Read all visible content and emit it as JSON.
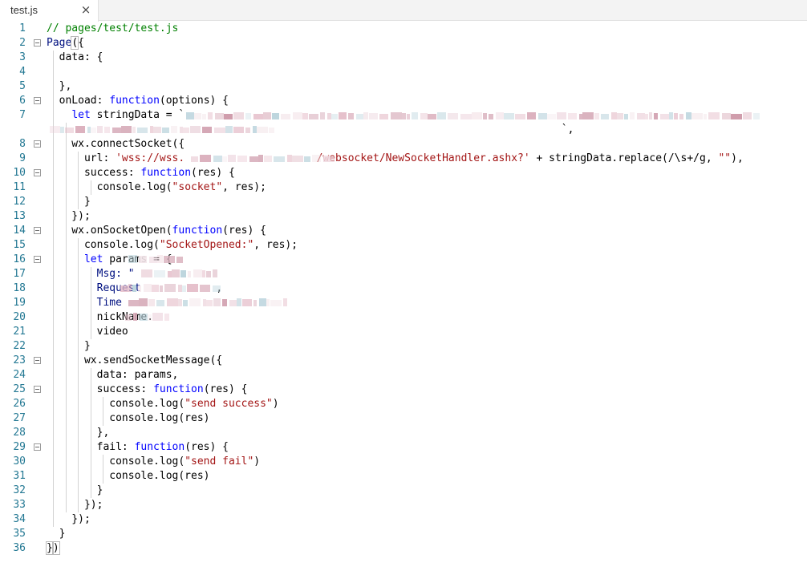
{
  "tab": {
    "title": "test.js",
    "close_icon": "close-icon"
  },
  "code_lines": [
    {
      "n": "1",
      "fold": false,
      "tokens": [
        {
          "t": "// pages/test/test.js",
          "c": "#008000"
        }
      ]
    },
    {
      "n": "2",
      "fold": true,
      "tokens": [
        {
          "t": "Page",
          "c": "#001080"
        },
        {
          "t": "(",
          "c": "#000000",
          "hl": true
        },
        {
          "t": "{",
          "c": "#000000"
        }
      ]
    },
    {
      "n": "3",
      "fold": false,
      "tokens": [
        {
          "t": "  data: {",
          "c": "#000000"
        }
      ]
    },
    {
      "n": "4",
      "fold": false,
      "tokens": []
    },
    {
      "n": "5",
      "fold": false,
      "tokens": [
        {
          "t": "  },",
          "c": "#000000"
        }
      ]
    },
    {
      "n": "6",
      "fold": true,
      "tokens": [
        {
          "t": "  onLoad: ",
          "c": "#000000"
        },
        {
          "t": "function",
          "c": "#0000ff"
        },
        {
          "t": "(options) {",
          "c": "#000000"
        }
      ]
    },
    {
      "n": "7",
      "fold": false,
      "tokens": [
        {
          "t": "    ",
          "c": "#000000"
        },
        {
          "t": "let",
          "c": "#0000ff"
        },
        {
          "t": " stringData = `",
          "c": "#000000"
        }
      ]
    },
    {
      "n": "",
      "fold": false,
      "tokens": [
        {
          "t": "                                                                                  `,",
          "c": "#000000"
        }
      ]
    },
    {
      "n": "8",
      "fold": true,
      "tokens": [
        {
          "t": "    wx.connectSocket({",
          "c": "#000000"
        }
      ]
    },
    {
      "n": "9",
      "fold": false,
      "tokens": [
        {
          "t": "      url: ",
          "c": "#000000"
        },
        {
          "t": "'wss://wss.",
          "c": "#a31515"
        },
        {
          "t": "                     ",
          "c": "#a31515"
        },
        {
          "t": "/websocket/NewSocketHandler.ashx?'",
          "c": "#a31515"
        },
        {
          "t": " + stringData.replace(/\\s+/g, ",
          "c": "#000000"
        },
        {
          "t": "\"\"",
          "c": "#a31515"
        },
        {
          "t": "),",
          "c": "#000000"
        }
      ]
    },
    {
      "n": "10",
      "fold": true,
      "tokens": [
        {
          "t": "      success: ",
          "c": "#000000"
        },
        {
          "t": "function",
          "c": "#0000ff"
        },
        {
          "t": "(res) {",
          "c": "#000000"
        }
      ]
    },
    {
      "n": "11",
      "fold": false,
      "tokens": [
        {
          "t": "        console.log(",
          "c": "#000000"
        },
        {
          "t": "\"socket\"",
          "c": "#a31515"
        },
        {
          "t": ", res);",
          "c": "#000000"
        }
      ]
    },
    {
      "n": "12",
      "fold": false,
      "tokens": [
        {
          "t": "      }",
          "c": "#000000"
        }
      ]
    },
    {
      "n": "13",
      "fold": false,
      "tokens": [
        {
          "t": "    });",
          "c": "#000000"
        }
      ]
    },
    {
      "n": "14",
      "fold": true,
      "tokens": [
        {
          "t": "    wx.onSocketOpen(",
          "c": "#000000"
        },
        {
          "t": "function",
          "c": "#0000ff"
        },
        {
          "t": "(res) {",
          "c": "#000000"
        }
      ]
    },
    {
      "n": "15",
      "fold": false,
      "tokens": [
        {
          "t": "      console.log(",
          "c": "#000000"
        },
        {
          "t": "\"SocketOpened:\"",
          "c": "#a31515"
        },
        {
          "t": ", res);",
          "c": "#000000"
        }
      ]
    },
    {
      "n": "16",
      "fold": true,
      "tokens": [
        {
          "t": "      ",
          "c": "#000000"
        },
        {
          "t": "let",
          "c": "#0000ff"
        },
        {
          "t": " params = {",
          "c": "#000000"
        }
      ]
    },
    {
      "n": "17",
      "fold": false,
      "tokens": [
        {
          "t": "        Msg: \"",
          "c": "#001080"
        }
      ]
    },
    {
      "n": "18",
      "fold": false,
      "tokens": [
        {
          "t": "        Request",
          "c": "#001080"
        },
        {
          "t": "            ,",
          "c": "#000000"
        }
      ]
    },
    {
      "n": "19",
      "fold": false,
      "tokens": [
        {
          "t": "        Time",
          "c": "#001080"
        }
      ]
    },
    {
      "n": "20",
      "fold": false,
      "tokens": [
        {
          "t": "        nickName.",
          "c": "#000000"
        }
      ]
    },
    {
      "n": "21",
      "fold": false,
      "tokens": [
        {
          "t": "        video",
          "c": "#000000"
        }
      ]
    },
    {
      "n": "22",
      "fold": false,
      "tokens": [
        {
          "t": "      }",
          "c": "#000000"
        }
      ]
    },
    {
      "n": "23",
      "fold": true,
      "tokens": [
        {
          "t": "      wx.sendSocketMessage({",
          "c": "#000000"
        }
      ]
    },
    {
      "n": "24",
      "fold": false,
      "tokens": [
        {
          "t": "        data: params,",
          "c": "#000000"
        }
      ]
    },
    {
      "n": "25",
      "fold": true,
      "tokens": [
        {
          "t": "        success: ",
          "c": "#000000"
        },
        {
          "t": "function",
          "c": "#0000ff"
        },
        {
          "t": "(res) {",
          "c": "#000000"
        }
      ]
    },
    {
      "n": "26",
      "fold": false,
      "tokens": [
        {
          "t": "          console.log(",
          "c": "#000000"
        },
        {
          "t": "\"send success\"",
          "c": "#a31515"
        },
        {
          "t": ")",
          "c": "#000000"
        }
      ]
    },
    {
      "n": "27",
      "fold": false,
      "tokens": [
        {
          "t": "          console.log(res)",
          "c": "#000000"
        }
      ]
    },
    {
      "n": "28",
      "fold": false,
      "tokens": [
        {
          "t": "        },",
          "c": "#000000"
        }
      ]
    },
    {
      "n": "29",
      "fold": true,
      "tokens": [
        {
          "t": "        fail: ",
          "c": "#000000"
        },
        {
          "t": "function",
          "c": "#0000ff"
        },
        {
          "t": "(res) {",
          "c": "#000000"
        }
      ]
    },
    {
      "n": "30",
      "fold": false,
      "tokens": [
        {
          "t": "          console.log(",
          "c": "#000000"
        },
        {
          "t": "\"send fail\"",
          "c": "#a31515"
        },
        {
          "t": ")",
          "c": "#000000"
        }
      ]
    },
    {
      "n": "31",
      "fold": false,
      "tokens": [
        {
          "t": "          console.log(res)",
          "c": "#000000"
        }
      ]
    },
    {
      "n": "32",
      "fold": false,
      "tokens": [
        {
          "t": "        }",
          "c": "#000000"
        }
      ]
    },
    {
      "n": "33",
      "fold": false,
      "tokens": [
        {
          "t": "      });",
          "c": "#000000"
        }
      ]
    },
    {
      "n": "34",
      "fold": false,
      "tokens": [
        {
          "t": "    });",
          "c": "#000000"
        }
      ]
    },
    {
      "n": "35",
      "fold": false,
      "tokens": [
        {
          "t": "  }",
          "c": "#000000"
        }
      ]
    },
    {
      "n": "36",
      "fold": false,
      "tokens": [
        {
          "t": "}",
          "c": "#000000",
          "hl": true
        },
        {
          "t": ")",
          "c": "#000000",
          "hl": true
        }
      ]
    }
  ],
  "colors": {
    "line_number": "#237893",
    "comment": "#008000",
    "keyword": "#0000ff",
    "string": "#a31515",
    "property": "#001080"
  }
}
